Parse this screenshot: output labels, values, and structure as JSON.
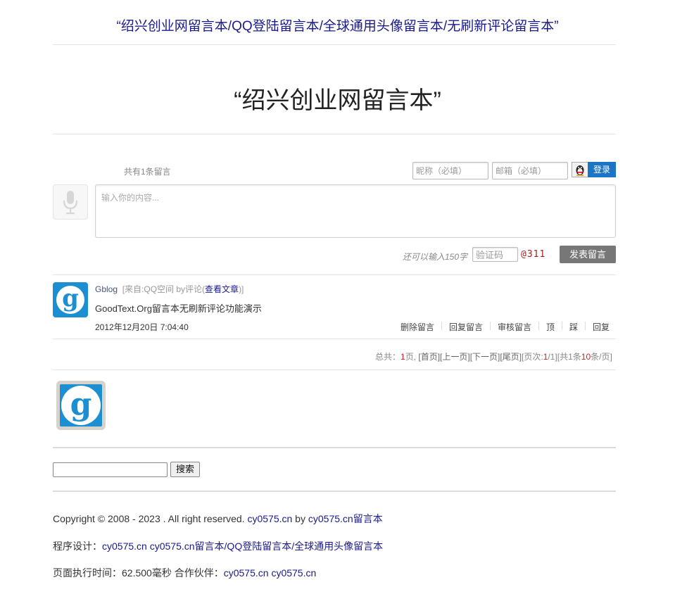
{
  "header": {
    "top_link": "“绍兴创业网留言本/QQ登陆留言本/全球通用头像留言本/无刷新评论留言本”",
    "title": "“绍兴创业网留言本”"
  },
  "form": {
    "count_text": "共有1条留言",
    "nickname_placeholder": "昵称（必填）",
    "email_placeholder": "邮箱（必填）",
    "login_label": "登录",
    "content_placeholder": "输入你的内容...",
    "remaining_text": "还可以输入150字",
    "captcha_placeholder": "验证码",
    "captcha_code": "@311",
    "submit_label": "发表留言"
  },
  "comments": [
    {
      "name": "Gblog",
      "source_prefix": "[来自:QQ空间 by评论(",
      "source_link": "查看文章",
      "source_suffix": ")]",
      "content": "GoodText.Org留言本无刷新评论功能演示",
      "time": "2012年12月20日 7:04:40",
      "actions": [
        "删除留言",
        "回复留言",
        "审核留言",
        "顶",
        "踩",
        "回复"
      ]
    }
  ],
  "pagination": {
    "prefix": "总共：",
    "total_pages": "1",
    "pages_unit": "页, ",
    "first": "[首页]",
    "prev": "[上一页]",
    "next": "[下一页]",
    "last": "[尾页]",
    "page_label": "[页次:",
    "current": "1",
    "page_sep": "/1]",
    "count_text": "[共1条",
    "per_page": "10",
    "per_page_suffix": "条/页]"
  },
  "search": {
    "button_label": "搜索"
  },
  "footer": {
    "copyright_text": "Copyright © 2008 - 2023 . All right reserved. ",
    "copyright_link1": "cy0575.cn",
    "copyright_by": " by ",
    "copyright_link2": "cy0575.cn留言本",
    "design_label": "程序设计：",
    "design_link1": "cy0575.cn",
    "design_link2": "cy0575.cn留言本/QQ登陆留言本/全球通用头像留言本",
    "exec_text": "页面执行时间：62.500毫秒 合作伙伴：",
    "partner_link1": "cy0575.cn",
    "partner_link2": "cy0575.cn"
  },
  "colors": {
    "link": "#1a1a8c",
    "login_button": "#1b74c4",
    "submit_button": "#777777",
    "avatar_blue": "#1b8fd1",
    "highlight_red": "#d42020"
  },
  "icons": [
    "qq-penguin-icon",
    "microphone-icon",
    "g-avatar-icon"
  ]
}
